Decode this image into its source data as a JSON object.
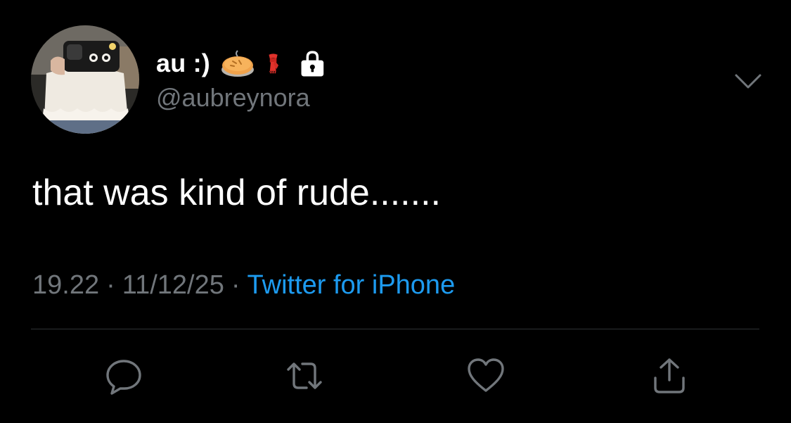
{
  "author": {
    "display_name": "au :)",
    "handle": "@aubreynora",
    "emojis": [
      "pie-emoji",
      "scarf-emoji"
    ],
    "protected_icon": "lock-icon"
  },
  "tweet": {
    "text": "that was kind of rude......."
  },
  "meta": {
    "time": "19.22",
    "separator": "·",
    "date": "11/12/25",
    "source": "Twitter for iPhone"
  },
  "actions": {
    "reply_icon": "reply-icon",
    "retweet_icon": "retweet-icon",
    "like_icon": "heart-icon",
    "share_icon": "share-icon"
  },
  "menu": {
    "icon": "chevron-down-icon"
  },
  "colors": {
    "background": "#000000",
    "text_primary": "#ffffff",
    "text_secondary": "#71767b",
    "link": "#1d9bf0",
    "divider": "#2f3336"
  }
}
